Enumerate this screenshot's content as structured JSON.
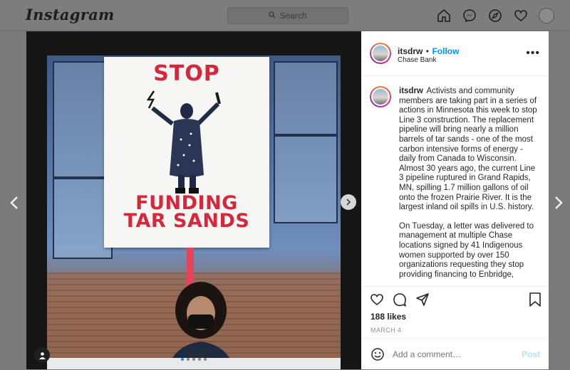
{
  "nav": {
    "logo": "Instagram",
    "search_placeholder": "Search",
    "icons": [
      "home-icon",
      "messenger-icon",
      "explore-icon",
      "heart-icon",
      "profile-avatar"
    ]
  },
  "sign": {
    "top_text": "STOP",
    "bottom_line1": "FUNDING",
    "bottom_line2": "TAR SANDS"
  },
  "carousel": {
    "count": 5,
    "active": 0
  },
  "post": {
    "username": "itsdrw",
    "follow_label": "Follow",
    "dot": "•",
    "location": "Chase Bank",
    "more": "•••",
    "caption_user": "itsdrw",
    "caption_p1": "Activists and community members are taking part in a series of actions in Minnesota this week to stop Line 3 construction. The replacement pipeline will bring nearly a million barrels of tar sands - one of the most carbon intensive forms of energy - daily from Canada to Wisconsin. Almost 30 years ago, the current Line 3 pipeline ruptured in Grand Rapids, MN, spilling 1.7 million gallons of oil onto the frozen Prairie River. It is the largest inland oil spills in U.S. history.",
    "caption_p2": "On Tuesday, a letter was delivered to management at multiple Chase locations signed by 41 Indigenous women supported by over 150 organizations requesting they stop providing financing to Enbridge,",
    "likes": "188 likes",
    "date": "MARCH 4",
    "comment_placeholder": "Add a comment…",
    "post_label": "Post"
  },
  "colors": {
    "sign_red": "#d6283a",
    "link_blue": "#0095f6",
    "post_disabled": "#b2dffc"
  }
}
